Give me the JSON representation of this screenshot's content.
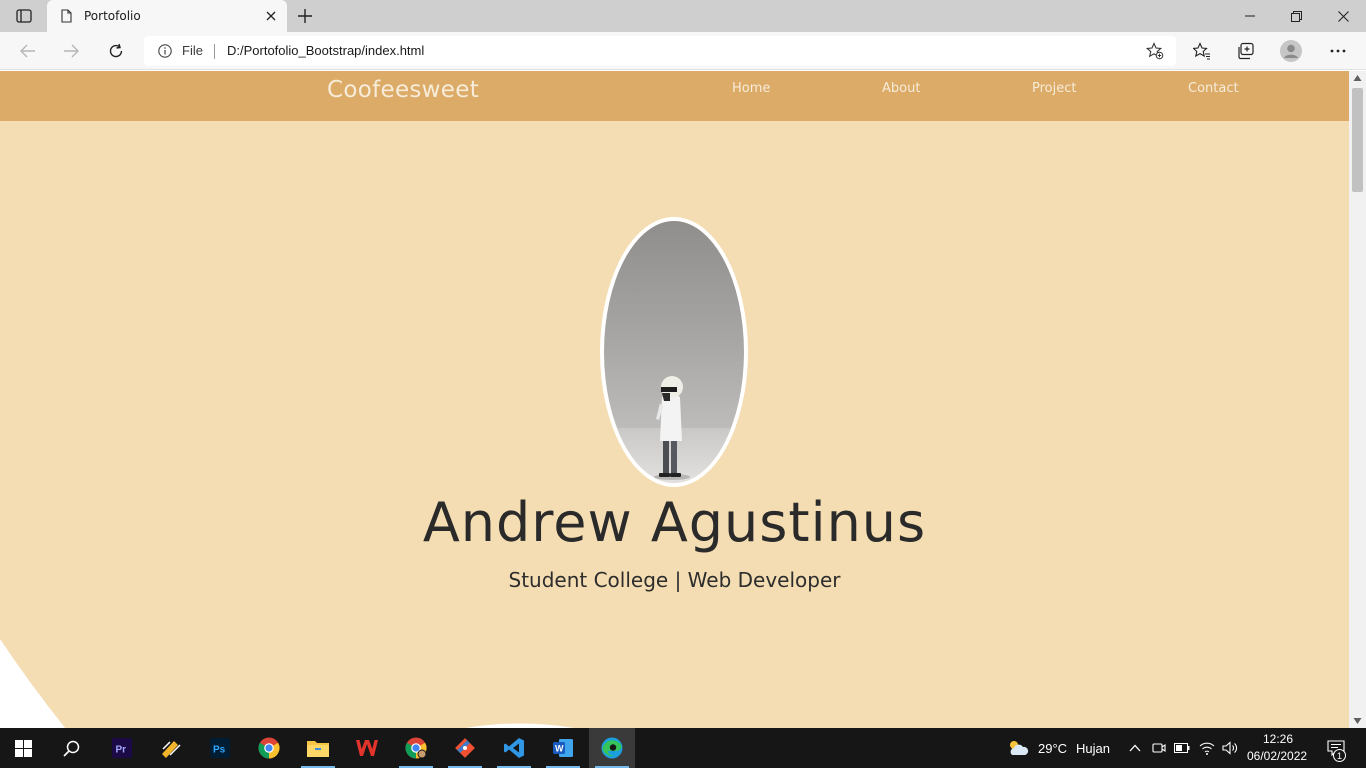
{
  "browser": {
    "tab": {
      "title": "Portofolio"
    },
    "address": {
      "scheme_label": "File",
      "url": "D:/Portofolio_Bootstrap/index.html"
    }
  },
  "site": {
    "brand": "Coofeesweet",
    "nav": [
      "Home",
      "About",
      "Project",
      "Contact"
    ],
    "hero": {
      "name": "Andrew Agustinus",
      "subtitle": "Student College | Web Developer"
    },
    "colors": {
      "navbar": "#dcab67",
      "background": "#f4ddb2",
      "text": "#2a2a2a"
    }
  },
  "taskbar": {
    "apps": [
      "start-icon",
      "search-icon",
      "premiere-pro-icon",
      "app-launcher-icon",
      "photoshop-icon",
      "chrome-icon",
      "file-explorer-icon",
      "wps-office-icon",
      "chrome-profile-icon",
      "git-icon",
      "vscode-icon",
      "word-icon",
      "edge-icon"
    ],
    "weather": {
      "temp": "29°C",
      "condition": "Hujan"
    },
    "clock": {
      "time": "12:26",
      "date": "06/02/2022"
    },
    "notifications": "1"
  }
}
